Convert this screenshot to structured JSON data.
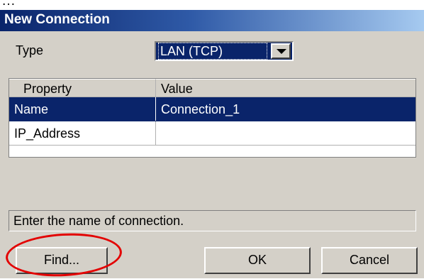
{
  "window": {
    "title": "New Connection"
  },
  "form": {
    "type_label": "Type",
    "type_value": "LAN (TCP)"
  },
  "grid": {
    "columns": [
      "Property",
      "Value"
    ],
    "rows": [
      {
        "property": "Name",
        "value": "Connection_1",
        "selected": true
      },
      {
        "property": "IP_Address",
        "value": "",
        "selected": false
      }
    ]
  },
  "status_text": "Enter the name of connection.",
  "buttons": {
    "find": "Find...",
    "ok": "OK",
    "cancel": "Cancel"
  },
  "annotation": {
    "color": "#e30000",
    "shape": "ellipse",
    "target": "find-button"
  },
  "icons": {
    "dropdown": "chevron-down-icon"
  },
  "colors": {
    "title_bar": "#0a246a",
    "selection": "#0a246a",
    "dialog_face": "#d4d0c8"
  }
}
